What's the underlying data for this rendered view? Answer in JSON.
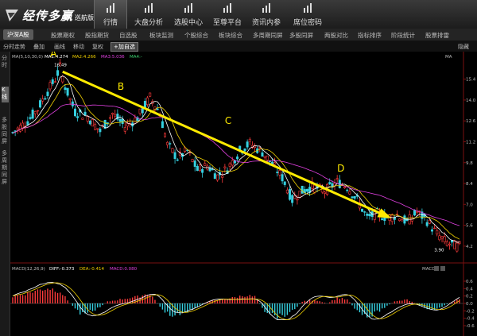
{
  "app": {
    "logo_text": "经传多赢",
    "logo_sub": "巡航版"
  },
  "nav": [
    {
      "label": "行情",
      "icon": "chart-icon",
      "active": true
    },
    {
      "label": "大盘分析",
      "icon": "line-chart-icon"
    },
    {
      "label": "选股中心",
      "icon": "bar-chart-icon"
    },
    {
      "label": "至尊平台",
      "icon": "crown-icon"
    },
    {
      "label": "资讯内参",
      "icon": "document-icon"
    },
    {
      "label": "席位密码",
      "icon": "search-icon"
    }
  ],
  "tabs": [
    "沪深A股",
    "股票期权",
    "股指期货",
    "自选股",
    "板块监测",
    "个股综合",
    "板块综合",
    "多周期同屏",
    "多股同屏",
    "两股对比",
    "指标排序",
    "阶段统计",
    "股票排雷"
  ],
  "toolbar": {
    "items": [
      "分时走势",
      "叠加",
      "画线",
      "移动",
      "复权"
    ],
    "add_label": "+加自选",
    "right_label": "隐藏"
  },
  "sidebar": {
    "items": [
      "分时",
      "K线",
      "多股同屏",
      "多周期同屏"
    ]
  },
  "indicators": {
    "ma": {
      "label": "MA(5,10,30,0)",
      "ma1": "MA1:4.274",
      "ma2": "MA2:4.266",
      "ma3": "MA3:5.036",
      "ma4": "MA4:-",
      "right": "MA"
    },
    "macd": {
      "label": "MACD(12,26,9)",
      "diff": "DIFF:-0.373",
      "dea": "DEA:-0.414",
      "macd": "MACD:0.080",
      "right": "MACD"
    }
  },
  "chart_data": {
    "type": "candlestick",
    "price_axis": {
      "ticks": [
        "15.4",
        "14.0",
        "12.6",
        "11.2",
        "9.8",
        "8.4",
        "7.0",
        "5.6",
        "4.2"
      ],
      "range": [
        3.5,
        16.5
      ]
    },
    "macd_axis": {
      "ticks": [
        "0.6",
        "0.4",
        "0.2",
        "0.0",
        "-0.2",
        "-0.4",
        "-0.6"
      ],
      "range": [
        -0.75,
        0.75
      ]
    },
    "annotations": [
      {
        "label": "A",
        "note": "16.49"
      },
      {
        "label": "B"
      },
      {
        "label": "C"
      },
      {
        "label": "D"
      }
    ],
    "low_note": "3.90",
    "anchors": [
      [
        0,
        11.8
      ],
      [
        6,
        12.6
      ],
      [
        10,
        13.4
      ],
      [
        14,
        14.6
      ],
      [
        17,
        15.4
      ],
      [
        19,
        16.2
      ],
      [
        21,
        14.9
      ],
      [
        25,
        13.2
      ],
      [
        30,
        12.9
      ],
      [
        35,
        11.9
      ],
      [
        40,
        13.1
      ],
      [
        45,
        12.2
      ],
      [
        50,
        12.8
      ],
      [
        55,
        14.2
      ],
      [
        59,
        13.1
      ],
      [
        62,
        11.0
      ],
      [
        66,
        10.1
      ],
      [
        70,
        10.6
      ],
      [
        74,
        9.3
      ],
      [
        78,
        9.6
      ],
      [
        82,
        8.9
      ],
      [
        86,
        9.4
      ],
      [
        91,
        10.6
      ],
      [
        95,
        11.1
      ],
      [
        100,
        10.5
      ],
      [
        104,
        9.7
      ],
      [
        108,
        8.8
      ],
      [
        112,
        7.3
      ],
      [
        115,
        7.8
      ],
      [
        120,
        8.2
      ],
      [
        125,
        7.9
      ],
      [
        130,
        8.5
      ],
      [
        134,
        8.2
      ],
      [
        138,
        7.3
      ],
      [
        142,
        6.1
      ],
      [
        146,
        6.4
      ],
      [
        150,
        6.1
      ],
      [
        154,
        6.3
      ],
      [
        158,
        5.8
      ],
      [
        162,
        6.5
      ],
      [
        166,
        5.9
      ],
      [
        170,
        5.0
      ],
      [
        174,
        4.4
      ],
      [
        178,
        4.2
      ]
    ],
    "macd_hist_anchors": [
      [
        0,
        0.18
      ],
      [
        8,
        0.32
      ],
      [
        14,
        0.42
      ],
      [
        19,
        0.33
      ],
      [
        23,
        0.0
      ],
      [
        27,
        -0.25
      ],
      [
        33,
        -0.18
      ],
      [
        38,
        0.05
      ],
      [
        44,
        0.12
      ],
      [
        50,
        0.18
      ],
      [
        55,
        0.28
      ],
      [
        59,
        -0.1
      ],
      [
        63,
        -0.32
      ],
      [
        68,
        -0.3
      ],
      [
        73,
        -0.12
      ],
      [
        78,
        0.05
      ],
      [
        83,
        0.1
      ],
      [
        88,
        0.15
      ],
      [
        93,
        0.22
      ],
      [
        97,
        0.18
      ],
      [
        101,
        -0.2
      ],
      [
        106,
        -0.35
      ],
      [
        111,
        -0.28
      ],
      [
        116,
        0.05
      ],
      [
        121,
        0.1
      ],
      [
        126,
        0.0
      ],
      [
        130,
        0.15
      ],
      [
        134,
        0.1
      ],
      [
        138,
        -0.2
      ],
      [
        143,
        -0.35
      ],
      [
        148,
        -0.15
      ],
      [
        153,
        0.05
      ],
      [
        158,
        0.1
      ],
      [
        163,
        -0.05
      ],
      [
        168,
        -0.2
      ],
      [
        173,
        -0.05
      ],
      [
        178,
        0.1
      ]
    ]
  }
}
